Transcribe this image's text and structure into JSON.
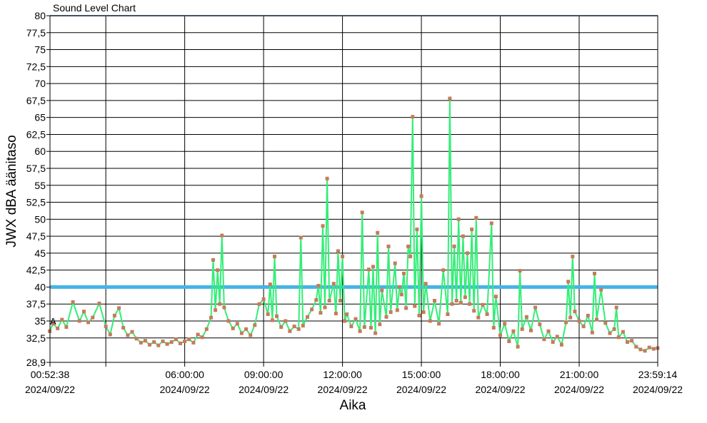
{
  "chart_data": {
    "type": "line",
    "title": "Sound Level Chart",
    "xlabel": "Aika",
    "ylabel": "JWX dBA äänitaso",
    "grid": true,
    "legend": "none",
    "ylim": [
      28.9,
      80
    ],
    "xlim": [
      "2024/09/22 00:52:38",
      "2024/09/22 23:59:14"
    ],
    "y_ticks": [
      "80",
      "77,5",
      "75",
      "72,5",
      "70",
      "67,5",
      "65",
      "62,5",
      "60",
      "57,5",
      "55",
      "52,5",
      "50",
      "47,5",
      "45",
      "42,5",
      "40",
      "37,5",
      "35",
      "32,5",
      "28,9"
    ],
    "x_ticks": [
      {
        "time": "00:52:38",
        "date": "2024/09/22"
      },
      {
        "time": "06:00:00",
        "date": "2024/09/22"
      },
      {
        "time": "09:00:00",
        "date": "2024/09/22"
      },
      {
        "time": "12:00:00",
        "date": "2024/09/22"
      },
      {
        "time": "15:00:00",
        "date": "2024/09/22"
      },
      {
        "time": "18:00:00",
        "date": "2024/09/22"
      },
      {
        "time": "21:00:00",
        "date": "2024/09/22"
      },
      {
        "time": "23:59:14",
        "date": "2024/09/22"
      }
    ],
    "limit_line": {
      "value": 40,
      "color": "#45b3e7"
    },
    "marker_label": "A",
    "series": [
      {
        "color": "#33ee77",
        "marker_color": "#c87a5a",
        "points": [
          [
            "00:52",
            33.5
          ],
          [
            "01:00",
            34.6
          ],
          [
            "01:10",
            33.9
          ],
          [
            "01:20",
            35.2
          ],
          [
            "01:30",
            34.1
          ],
          [
            "01:45",
            37.8
          ],
          [
            "02:00",
            35.0
          ],
          [
            "02:10",
            36.4
          ],
          [
            "02:20",
            34.8
          ],
          [
            "02:30",
            35.5
          ],
          [
            "02:45",
            37.6
          ],
          [
            "03:00",
            34.2
          ],
          [
            "03:10",
            33.0
          ],
          [
            "03:20",
            35.8
          ],
          [
            "03:30",
            36.9
          ],
          [
            "03:40",
            34.0
          ],
          [
            "03:50",
            32.9
          ],
          [
            "04:00",
            33.4
          ],
          [
            "04:10",
            32.4
          ],
          [
            "04:20",
            31.8
          ],
          [
            "04:30",
            32.1
          ],
          [
            "04:40",
            31.5
          ],
          [
            "04:50",
            31.9
          ],
          [
            "05:00",
            31.4
          ],
          [
            "05:10",
            32.0
          ],
          [
            "05:20",
            31.6
          ],
          [
            "05:30",
            31.9
          ],
          [
            "05:40",
            32.3
          ],
          [
            "05:50",
            31.7
          ],
          [
            "06:00",
            32.0
          ],
          [
            "06:10",
            32.3
          ],
          [
            "06:20",
            31.8
          ],
          [
            "06:30",
            33.0
          ],
          [
            "06:40",
            32.6
          ],
          [
            "06:50",
            33.8
          ],
          [
            "07:00",
            35.5
          ],
          [
            "07:05",
            44.0
          ],
          [
            "07:10",
            36.6
          ],
          [
            "07:15",
            42.5
          ],
          [
            "07:20",
            37.5
          ],
          [
            "07:25",
            47.6
          ],
          [
            "07:30",
            37.0
          ],
          [
            "07:40",
            35.0
          ],
          [
            "07:50",
            33.9
          ],
          [
            "08:00",
            34.6
          ],
          [
            "08:10",
            33.2
          ],
          [
            "08:20",
            33.8
          ],
          [
            "08:30",
            32.9
          ],
          [
            "08:40",
            34.4
          ],
          [
            "08:50",
            37.5
          ],
          [
            "09:00",
            38.2
          ],
          [
            "09:10",
            36.0
          ],
          [
            "09:15",
            40.4
          ],
          [
            "09:20",
            35.1
          ],
          [
            "09:25",
            44.5
          ],
          [
            "09:30",
            35.7
          ],
          [
            "09:40",
            34.1
          ],
          [
            "09:50",
            35.0
          ],
          [
            "10:00",
            33.5
          ],
          [
            "10:10",
            34.2
          ],
          [
            "10:20",
            33.8
          ],
          [
            "10:25",
            47.3
          ],
          [
            "10:30",
            34.3
          ],
          [
            "10:40",
            35.6
          ],
          [
            "10:50",
            36.7
          ],
          [
            "11:00",
            38.1
          ],
          [
            "11:05",
            40.2
          ],
          [
            "11:10",
            36.2
          ],
          [
            "11:15",
            49.0
          ],
          [
            "11:20",
            37.0
          ],
          [
            "11:25",
            56.0
          ],
          [
            "11:30",
            38.0
          ],
          [
            "11:40",
            40.5
          ],
          [
            "11:45",
            36.1
          ],
          [
            "11:50",
            45.3
          ],
          [
            "11:55",
            38.0
          ],
          [
            "12:00",
            44.5
          ],
          [
            "12:05",
            35.0
          ],
          [
            "12:10",
            36.0
          ],
          [
            "12:20",
            34.2
          ],
          [
            "12:30",
            35.3
          ],
          [
            "12:40",
            33.5
          ],
          [
            "12:45",
            51.0
          ],
          [
            "12:50",
            34.1
          ],
          [
            "13:00",
            42.6
          ],
          [
            "13:05",
            34.0
          ],
          [
            "13:10",
            43.0
          ],
          [
            "13:15",
            33.2
          ],
          [
            "13:20",
            48.0
          ],
          [
            "13:25",
            34.5
          ],
          [
            "13:30",
            39.5
          ],
          [
            "13:40",
            35.6
          ],
          [
            "13:45",
            46.0
          ],
          [
            "13:50",
            36.3
          ],
          [
            "14:00",
            43.5
          ],
          [
            "14:05",
            36.6
          ],
          [
            "14:10",
            40.0
          ],
          [
            "14:15",
            38.9
          ],
          [
            "14:20",
            42.0
          ],
          [
            "14:25",
            36.9
          ],
          [
            "14:30",
            46.0
          ],
          [
            "14:35",
            44.5
          ],
          [
            "14:40",
            65.1
          ],
          [
            "14:45",
            37.2
          ],
          [
            "14:50",
            48.5
          ],
          [
            "14:55",
            35.8
          ],
          [
            "15:00",
            53.4
          ],
          [
            "15:05",
            36.3
          ],
          [
            "15:10",
            40.5
          ],
          [
            "15:20",
            35.0
          ],
          [
            "15:30",
            38.0
          ],
          [
            "15:40",
            34.6
          ],
          [
            "15:50",
            42.5
          ],
          [
            "16:00",
            36.0
          ],
          [
            "16:05",
            67.8
          ],
          [
            "16:10",
            37.5
          ],
          [
            "16:15",
            46.0
          ],
          [
            "16:20",
            38.0
          ],
          [
            "16:25",
            50.0
          ],
          [
            "16:30",
            37.7
          ],
          [
            "16:35",
            47.5
          ],
          [
            "16:40",
            38.5
          ],
          [
            "16:45",
            45.0
          ],
          [
            "16:50",
            37.5
          ],
          [
            "16:55",
            48.5
          ],
          [
            "17:00",
            36.5
          ],
          [
            "17:05",
            50.2
          ],
          [
            "17:10",
            35.5
          ],
          [
            "17:20",
            37.4
          ],
          [
            "17:30",
            36.0
          ],
          [
            "17:40",
            49.4
          ],
          [
            "17:45",
            34.0
          ],
          [
            "17:50",
            38.6
          ],
          [
            "18:00",
            32.9
          ],
          [
            "18:10",
            34.6
          ],
          [
            "18:20",
            32.0
          ],
          [
            "18:30",
            33.5
          ],
          [
            "18:40",
            31.2
          ],
          [
            "18:45",
            42.4
          ],
          [
            "18:50",
            33.8
          ],
          [
            "19:00",
            35.6
          ],
          [
            "19:10",
            33.6
          ],
          [
            "19:20",
            37.0
          ],
          [
            "19:30",
            34.5
          ],
          [
            "19:40",
            32.3
          ],
          [
            "19:50",
            33.5
          ],
          [
            "20:00",
            31.9
          ],
          [
            "20:10",
            32.7
          ],
          [
            "20:20",
            31.5
          ],
          [
            "20:30",
            34.8
          ],
          [
            "20:35",
            40.8
          ],
          [
            "20:40",
            35.5
          ],
          [
            "20:45",
            44.5
          ],
          [
            "20:50",
            36.4
          ],
          [
            "21:00",
            35.0
          ],
          [
            "21:10",
            34.2
          ],
          [
            "21:20",
            35.8
          ],
          [
            "21:30",
            33.3
          ],
          [
            "21:35",
            42.0
          ],
          [
            "21:40",
            35.2
          ],
          [
            "21:50",
            39.6
          ],
          [
            "22:00",
            34.7
          ],
          [
            "22:10",
            33.2
          ],
          [
            "22:20",
            33.8
          ],
          [
            "22:25",
            37.0
          ],
          [
            "22:30",
            32.6
          ],
          [
            "22:40",
            33.4
          ],
          [
            "22:50",
            31.9
          ],
          [
            "23:00",
            32.1
          ],
          [
            "23:10",
            31.2
          ],
          [
            "23:20",
            30.8
          ],
          [
            "23:30",
            30.6
          ],
          [
            "23:40",
            31.1
          ],
          [
            "23:50",
            30.9
          ],
          [
            "23:59",
            31.0
          ]
        ]
      }
    ]
  }
}
